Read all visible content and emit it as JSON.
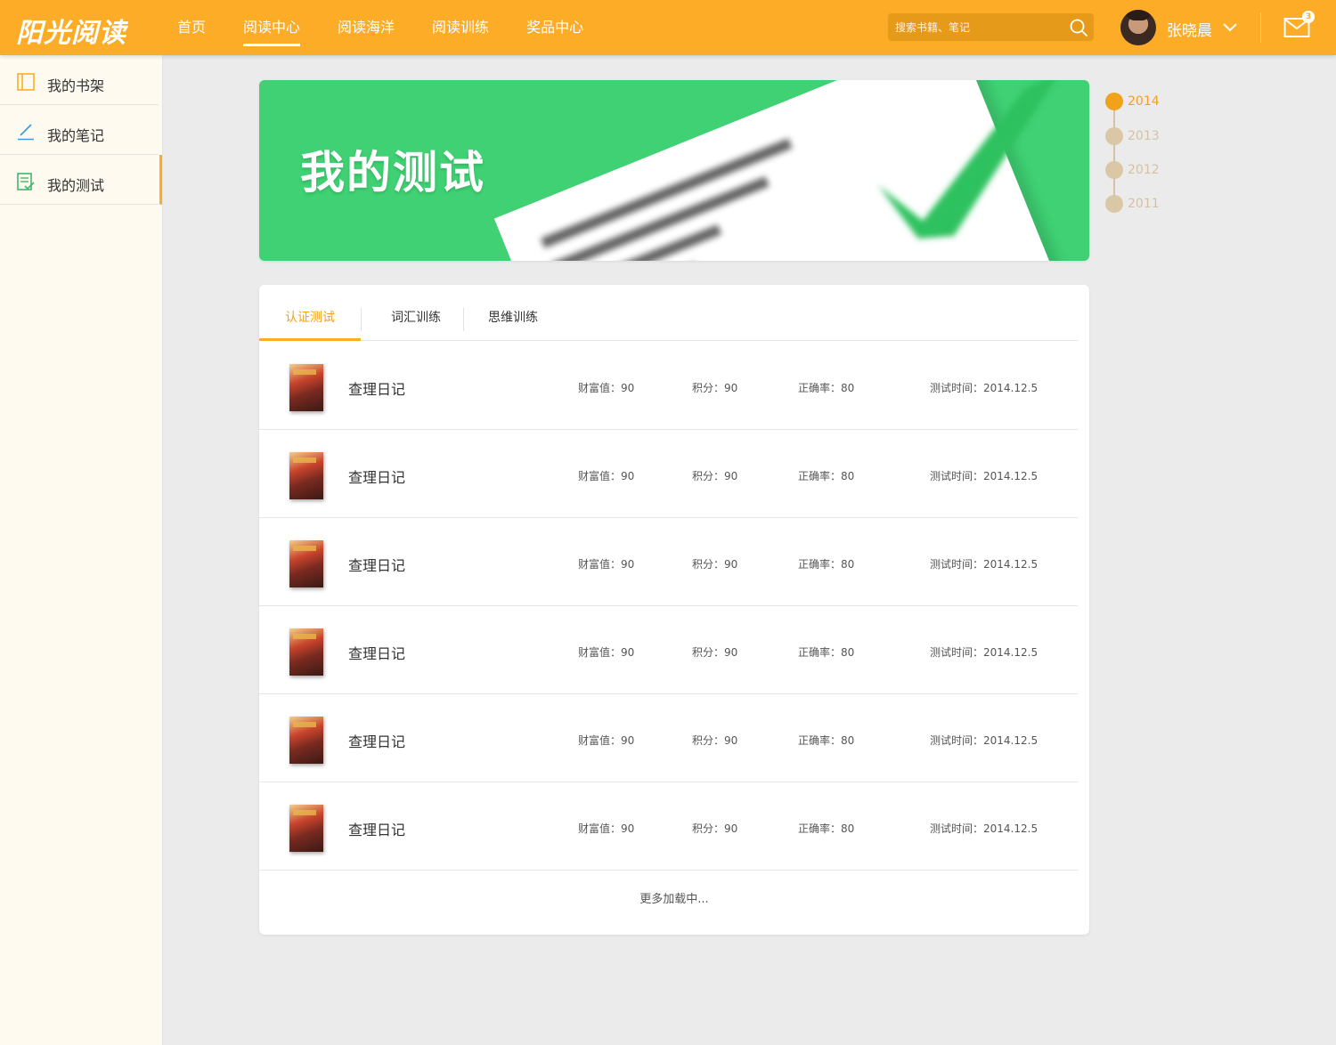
{
  "header": {
    "logo": "阳光阅读",
    "nav": [
      "首页",
      "阅读中心",
      "阅读海洋",
      "阅读训练",
      "奖品中心"
    ],
    "nav_active_index": 1,
    "search_placeholder": "搜索书籍、笔记",
    "username": "张晓晨",
    "mail_badge": "3",
    "accent_color": "#fcac26"
  },
  "sidebar": {
    "items": [
      {
        "label": "我的书架",
        "icon": "bookshelf-icon"
      },
      {
        "label": "我的笔记",
        "icon": "pen-icon"
      },
      {
        "label": "我的测试",
        "icon": "test-icon"
      }
    ],
    "active_index": 2
  },
  "banner": {
    "title": "我的测试",
    "background_color": "#3fd173"
  },
  "timeline": {
    "years": [
      "2014",
      "2013",
      "2012",
      "2011"
    ],
    "active_index": 0
  },
  "main": {
    "tabs": [
      "认证测试",
      "词汇训练",
      "思维训练"
    ],
    "active_tab": 0,
    "rows": [
      {
        "title": "查理日记",
        "wealth": "财富值：90",
        "points": "积分：90",
        "accuracy": "正确率：80",
        "time": "测试时间：2014.12.5"
      },
      {
        "title": "查理日记",
        "wealth": "财富值：90",
        "points": "积分：90",
        "accuracy": "正确率：80",
        "time": "测试时间：2014.12.5"
      },
      {
        "title": "查理日记",
        "wealth": "财富值：90",
        "points": "积分：90",
        "accuracy": "正确率：80",
        "time": "测试时间：2014.12.5"
      },
      {
        "title": "查理日记",
        "wealth": "财富值：90",
        "points": "积分：90",
        "accuracy": "正确率：80",
        "time": "测试时间：2014.12.5"
      },
      {
        "title": "查理日记",
        "wealth": "财富值：90",
        "points": "积分：90",
        "accuracy": "正确率：80",
        "time": "测试时间：2014.12.5"
      },
      {
        "title": "查理日记",
        "wealth": "财富值：90",
        "points": "积分：90",
        "accuracy": "正确率：80",
        "time": "测试时间：2014.12.5"
      }
    ],
    "load_more": "更多加载中..."
  }
}
